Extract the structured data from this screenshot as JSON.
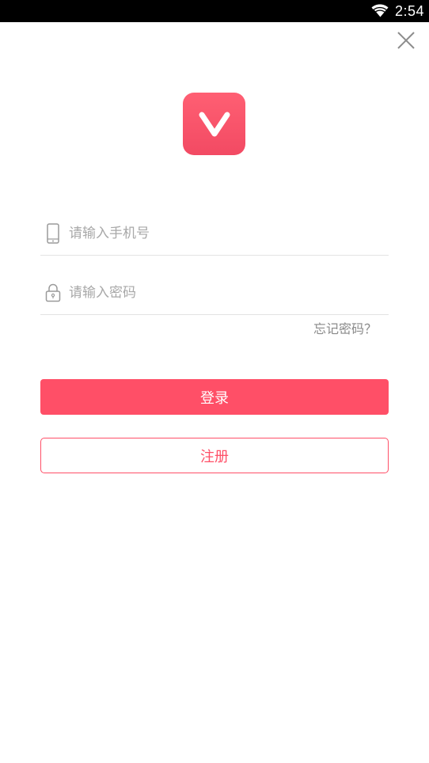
{
  "status_bar": {
    "time": "2:54",
    "wifi_icon": "wifi-icon"
  },
  "header": {
    "close_icon": "close-icon"
  },
  "logo": {
    "icon": "app-logo-v",
    "color": "#ff5468"
  },
  "form": {
    "phone": {
      "icon": "phone-icon",
      "placeholder": "请输入手机号",
      "value": ""
    },
    "password": {
      "icon": "lock-icon",
      "placeholder": "请输入密码",
      "value": ""
    },
    "forgot_password_label": "忘记密码？"
  },
  "actions": {
    "login_label": "登录",
    "register_label": "注册"
  },
  "colors": {
    "accent": "#ff4f67",
    "placeholder": "#a8a8a8",
    "divider": "#e3e3e3",
    "status_bar": "#000000"
  }
}
